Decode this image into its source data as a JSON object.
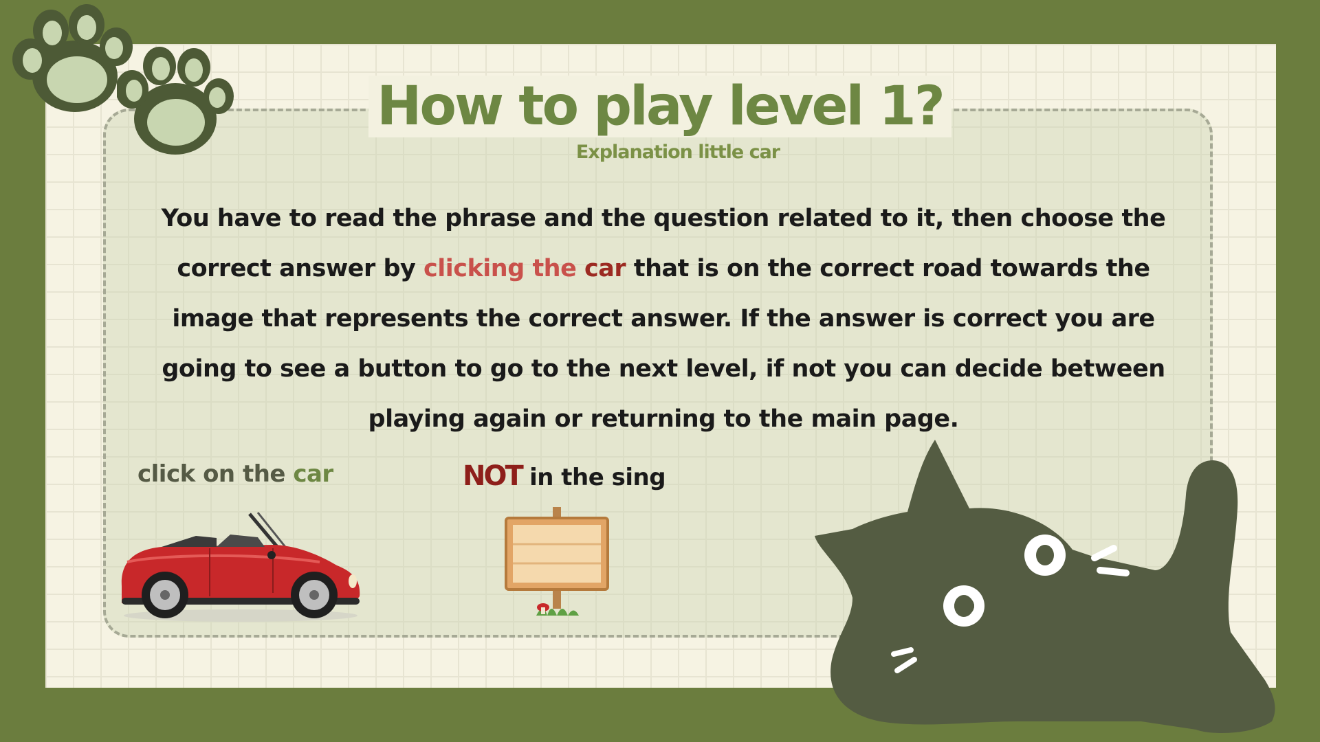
{
  "title": "How to play level 1?",
  "subtitle": "Explanation little car",
  "instructions": {
    "part1": "You have to read the phrase and the question related to it, then choose the correct answer by ",
    "highlight1": "clicking the",
    "space": " ",
    "highlight2": "car",
    "part2": " that is on the correct road towards the image that represents the correct answer. If the answer is correct you are going to see a button to go to the next level, if not you can decide between playing again or returning to the main page."
  },
  "hints": {
    "car_prefix": "click on the ",
    "car_accent": "car",
    "not_word": "NOT",
    "not_rest": " in the  sing"
  },
  "colors": {
    "background": "#6b7d3e",
    "paper": "#f6f3e3",
    "title": "#6d8743",
    "highlight_light_red": "#c9514b",
    "highlight_dark_red": "#9c2a22",
    "cat": "#545c42"
  },
  "icons": [
    "paw-icon",
    "paw-icon",
    "car-image",
    "wooden-sign-image",
    "cat-illustration"
  ]
}
